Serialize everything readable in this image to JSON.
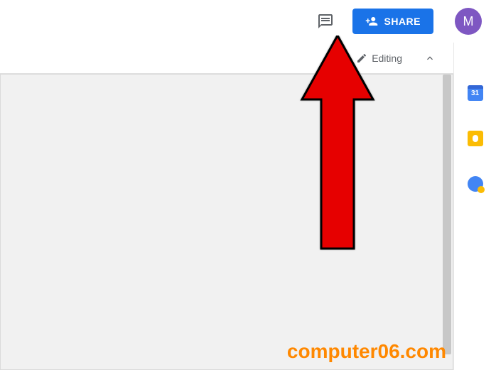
{
  "header": {
    "share_label": "SHARE",
    "avatar_initial": "M"
  },
  "toolbar": {
    "mode_label": "Editing"
  },
  "side_panel": {
    "calendar_day": "31"
  },
  "watermark": "computer06.com"
}
